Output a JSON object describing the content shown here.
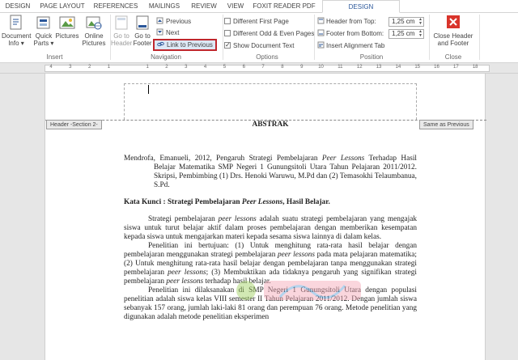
{
  "tabs": [
    "DESIGN",
    "PAGE LAYOUT",
    "REFERENCES",
    "MAILINGS",
    "REVIEW",
    "VIEW",
    "FOXIT READER PDF",
    "DESIGN"
  ],
  "active_tab_index": 7,
  "ribbon": {
    "insert": {
      "label": "Insert",
      "document_info": "Document Info",
      "document_info_l1": "Document",
      "document_info_l2": "Info",
      "quick_parts_l1": "Quick",
      "quick_parts_l2": "Parts",
      "pictures": "Pictures",
      "online_pictures_l1": "Online",
      "online_pictures_l2": "Pictures"
    },
    "navigation": {
      "label": "Navigation",
      "go_to_header_l1": "Go to",
      "go_to_header_l2": "Header",
      "go_to_footer_l1": "Go to",
      "go_to_footer_l2": "Footer",
      "previous": "Previous",
      "next": "Next",
      "link_to_previous": "Link to Previous"
    },
    "options": {
      "label": "Options",
      "different_first_page": "Different First Page",
      "different_odd_even": "Different Odd & Even Pages",
      "show_document_text": "Show Document Text",
      "different_first_page_checked": false,
      "different_odd_even_checked": false,
      "show_document_text_checked": true
    },
    "position": {
      "label": "Position",
      "header_from_top_label": "Header from Top:",
      "header_from_top_value": "1,25 cm",
      "footer_from_bottom_label": "Footer from Bottom:",
      "footer_from_bottom_value": "1,25 cm",
      "insert_alignment_tab": "Insert Alignment Tab"
    },
    "close": {
      "label": "Close",
      "close_header_l1": "Close Header",
      "close_header_l2": "and Footer"
    }
  },
  "ruler": {
    "numbers": [
      "4",
      "3",
      "2",
      "1",
      "",
      "1",
      "2",
      "3",
      "4",
      "5",
      "6",
      "7",
      "8",
      "9",
      "10",
      "11",
      "12",
      "13",
      "14",
      "15",
      "16",
      "17",
      "18"
    ]
  },
  "page": {
    "header_tag": "Header -Section 2-",
    "same_as_previous": "Same as Previous",
    "title": "ABSTRAK",
    "citation": "Mendrofa, Emanueli, 2012, Pengaruh Strategi Pembelajaran ",
    "citation_italic": "Peer Lessons",
    "citation_rest": " Terhadap Hasil Belajar Matematika SMP Negeri 1 Gunungsitoli Utara Tahun Pelajaran 2011/2012. Skripsi, Pembimbing (1) Drs. Henoki Waruwu, M.Pd dan (2) Temasokhi Telaumbanua, S.Pd.",
    "keywords_label": "Kata Kunci :  Strategi Pembelajaran ",
    "keywords_italic": "Peer Lessons",
    "keywords_rest": ", Hasil Belajar.",
    "para1_a": "Strategi pembelajaran ",
    "para1_i": "peer lessons",
    "para1_b": " adalah suatu strategi pembelajaran yang mengajak siswa untuk turut belajar aktif dalam proses pembelajaran dengan memberikan kesempatan kepada siswa untuk mengajarkan materi kepada sesama siswa lainnya di dalam kelas.",
    "para2_a": "Penelitian ini bertujuan: (1) Untuk menghitung rata-rata hasil belajar dengan pembelajaran menggunakan strategi pembelajaran ",
    "para2_i1": "peer lessons",
    "para2_b": " pada mata pelajaran matematika; (2) Untuk menghitung rata-rata hasil belajar dengan pembelajaran tanpa menggunakan strategi pembelajaran ",
    "para2_i2": "peer lessons",
    "para2_c": "; (3) Membuktikan ada tidaknya pengaruh yang signifikan strategi pembelajaran ",
    "para2_i3": "peer lessons",
    "para2_d": " terhadap hasil belajar.",
    "para3": "Penelitian ini dilaksanakan di SMP Negeri 1 Gunungsitoli Utara dengan populasi penelitian adalah siswa kelas VIII semester II Tahun Pelajaran 2011/2012. Dengan jumlah siswa sebanyak 157 orang, jumlah laki-laki 81 orang dan perempuan 76 orang. Metode penelitian yang digunakan adalah metode penelitian eksperimen"
  },
  "colors": {
    "accent": "#2b579a",
    "highlight_border": "#c0272d",
    "close_red": "#d9342b"
  }
}
